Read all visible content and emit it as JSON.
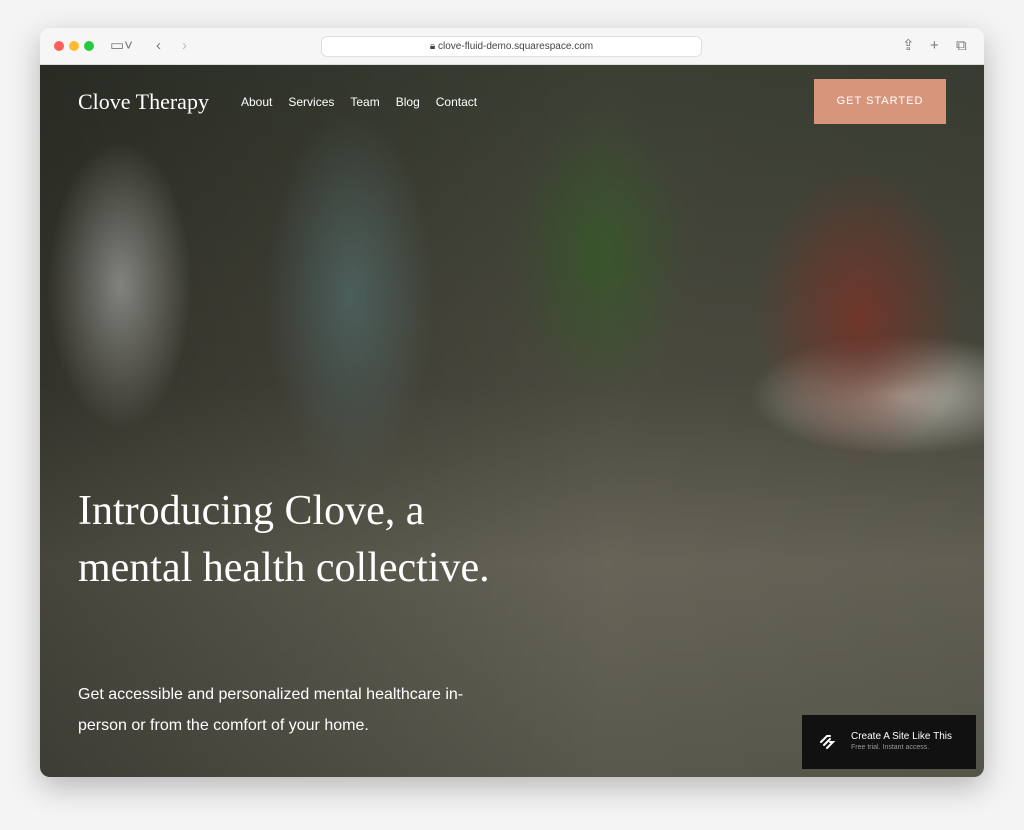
{
  "browser": {
    "url": "clove-fluid-demo.squarespace.com"
  },
  "site": {
    "logo": "Clove Therapy",
    "nav": [
      "About",
      "Services",
      "Team",
      "Blog",
      "Contact"
    ],
    "cta": "GET STARTED",
    "headline": "Introducing Clove, a mental health collective.",
    "subtext": "Get accessible and personalized mental healthcare in-person or from the comfort of your home.",
    "badge": {
      "title": "Create A Site Like This",
      "subtitle": "Free trial. Instant access."
    },
    "accent": "#d7967c"
  }
}
